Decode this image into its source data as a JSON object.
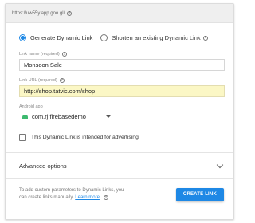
{
  "url_bar": {
    "text": "https://uw55y.app.goo.gl/"
  },
  "link_type": {
    "options": [
      {
        "label": "Generate Dynamic Link",
        "selected": true
      },
      {
        "label": "Shorten an existing Dynamic Link",
        "selected": false
      }
    ]
  },
  "link_name": {
    "label": "Link name (required)",
    "value": "Monsoon Sale"
  },
  "link_url": {
    "label": "Link URL (required)",
    "value": "http://shop.tatvic.com/shop"
  },
  "android_app": {
    "label": "Android app",
    "value": "com.rj.firebasedemo"
  },
  "advertising_checkbox": {
    "label": "This Dynamic Link is intended for advertising",
    "checked": false
  },
  "advanced": {
    "label": "Advanced options"
  },
  "footer": {
    "text_line1": "To add custom parameters to Dynamic Links, you",
    "text_line2_prefix": "can create links manually.",
    "learn_more": "Learn more",
    "create_button": "CREATE LINK"
  },
  "colors": {
    "accent": "#1e88e5",
    "highlight": "#fbf7c5",
    "android": "#3dba6f"
  }
}
